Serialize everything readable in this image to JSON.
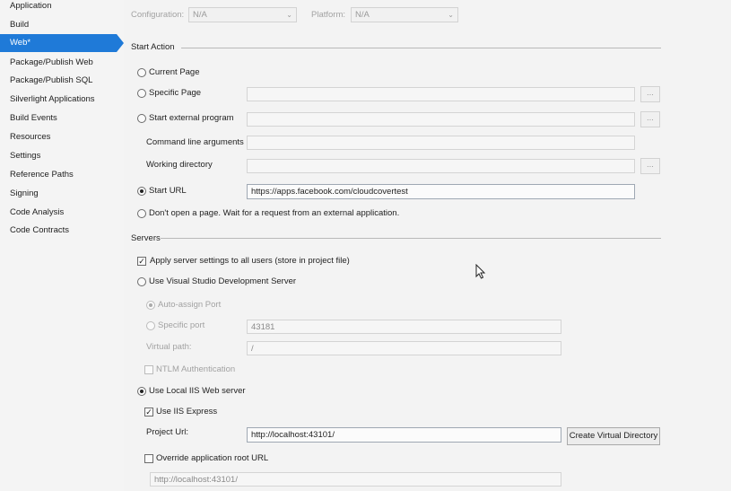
{
  "sidebar": {
    "items": [
      {
        "label": "Application"
      },
      {
        "label": "Build"
      },
      {
        "label": "Web*",
        "active": true
      },
      {
        "label": "Package/Publish Web"
      },
      {
        "label": "Package/Publish SQL"
      },
      {
        "label": "Silverlight Applications"
      },
      {
        "label": "Build Events"
      },
      {
        "label": "Resources"
      },
      {
        "label": "Settings"
      },
      {
        "label": "Reference Paths"
      },
      {
        "label": "Signing"
      },
      {
        "label": "Code Analysis"
      },
      {
        "label": "Code Contracts"
      }
    ]
  },
  "config": {
    "configuration_label": "Configuration:",
    "configuration_value": "N/A",
    "platform_label": "Platform:",
    "platform_value": "N/A"
  },
  "start_action": {
    "title": "Start Action",
    "current_page": "Current Page",
    "specific_page": "Specific Page",
    "start_external": "Start external program",
    "cmd_args": "Command line arguments",
    "working_dir": "Working directory",
    "start_url": "Start URL",
    "start_url_value": "https://apps.facebook.com/cloudcovertest",
    "dont_open": "Don't open a page.  Wait for a request from an external application.",
    "ellipsis": "..."
  },
  "servers": {
    "title": "Servers",
    "apply_all": "Apply server settings to all users (store in project file)",
    "use_vs_dev": "Use Visual Studio Development Server",
    "auto_assign": "Auto-assign Port",
    "specific_port": "Specific port",
    "port_value": "43181",
    "virtual_path": "Virtual path:",
    "virtual_path_value": "/",
    "ntlm": "NTLM Authentication",
    "use_local_iis": "Use Local IIS Web server",
    "use_iis_express": "Use IIS Express",
    "project_url": "Project Url:",
    "project_url_value": "http://localhost:43101/",
    "create_vdir": "Create Virtual Directory",
    "override_root": "Override application root URL",
    "override_value": "http://localhost:43101/",
    "check_mark": "✓"
  },
  "colors": {
    "accent": "#1f7ad8",
    "background": "#f3f3f3"
  }
}
